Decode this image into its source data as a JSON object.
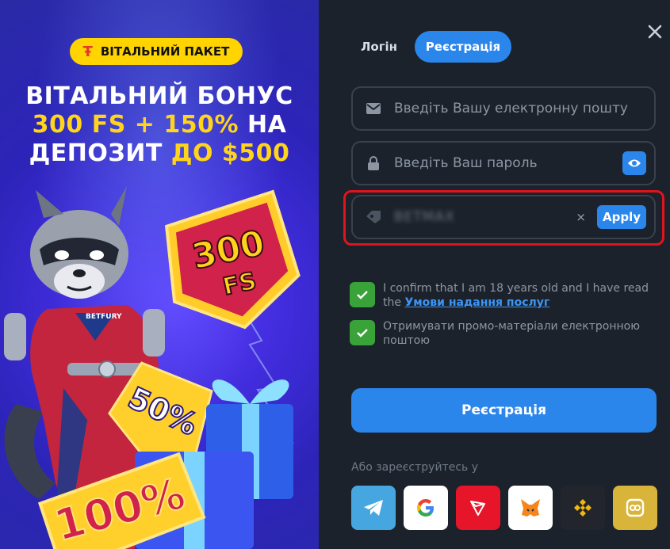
{
  "promo": {
    "pill_label": "ВІТАЛЬНИЙ ПАКЕТ",
    "headline_line1": "ВІТАЛЬНИЙ БОНУС",
    "headline_line2_yellow": "300 FS + 150%",
    "headline_line2_white": " НА",
    "headline_line3_white": "ДЕПОЗИТ ",
    "headline_line3_yellow": "ДО $500",
    "badge_fs_number": "300",
    "badge_fs_unit": "FS",
    "badge_50": "50%",
    "badge_100": "100%",
    "suit_logo": "BETFURY"
  },
  "tabs": [
    {
      "label": "Логін",
      "active": false
    },
    {
      "label": "Реєстрація",
      "active": true
    }
  ],
  "form": {
    "email_placeholder": "Введіть Вашу електронну пошту",
    "password_placeholder": "Введіть Ваш пароль",
    "promo_code_value": "BETMAX",
    "apply_label": "Apply",
    "clear_icon": "×",
    "consent_text": "I confirm that I am 18 years old and I have read the ",
    "consent_link": "Умови надання послуг",
    "marketing_text": "Отримувати промо-матеріали електронною поштою",
    "submit_label": "Реєстрація",
    "alt_signup_label": "Або зареєструйтесь у"
  },
  "social": [
    "telegram-icon",
    "google-icon",
    "tron-icon",
    "metamask-icon",
    "binance-icon",
    "alt-wallet-icon"
  ],
  "colors": {
    "accent": "#2b86ec",
    "checkbox": "#39a33a",
    "highlight": "#e0141e",
    "promo_yellow": "#ffd41a"
  }
}
